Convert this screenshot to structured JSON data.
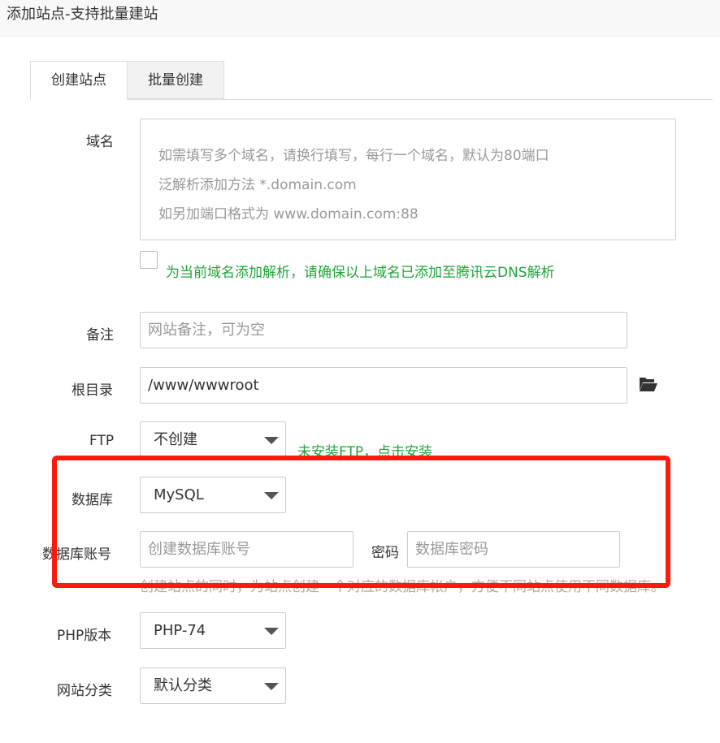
{
  "window": {
    "title": "添加站点-支持批量建站"
  },
  "tabs": [
    {
      "label": "创建站点",
      "active": true
    },
    {
      "label": "批量创建",
      "active": false
    }
  ],
  "domain": {
    "label": "域名",
    "placeholder_lines": [
      "如需填写多个域名，请换行填写，每行一个域名，默认为80端口",
      "泛解析添加方法 *.domain.com",
      "如另加端口格式为 www.domain.com:88"
    ],
    "dns_checkbox_label": "为当前域名添加解析，请确保以上域名已添加至腾讯云DNS解析",
    "dns_checked": false
  },
  "remark": {
    "label": "备注",
    "placeholder": "网站备注，可为空"
  },
  "root_dir": {
    "label": "根目录",
    "value": "/www/wwwroot",
    "icon": "folder-open-icon"
  },
  "ftp": {
    "label": "FTP",
    "selected": "不创建",
    "notice": "未安装FTP，点击安装"
  },
  "database": {
    "label": "数据库",
    "selected": "MySQL"
  },
  "db_account": {
    "label": "数据库账号",
    "user_placeholder": "创建数据库账号",
    "password_label": "密码",
    "password_placeholder": "数据库密码",
    "hint": "创建站点的同时，为站点创建一个对应的数据库帐户，方便不同站点使用不同数据库。"
  },
  "php_version": {
    "label": "PHP版本",
    "selected": "PHP-74"
  },
  "site_category": {
    "label": "网站分类",
    "selected": "默认分类"
  },
  "colors": {
    "accent_green": "#20a53a",
    "highlight_red": "#ff1a0f"
  }
}
